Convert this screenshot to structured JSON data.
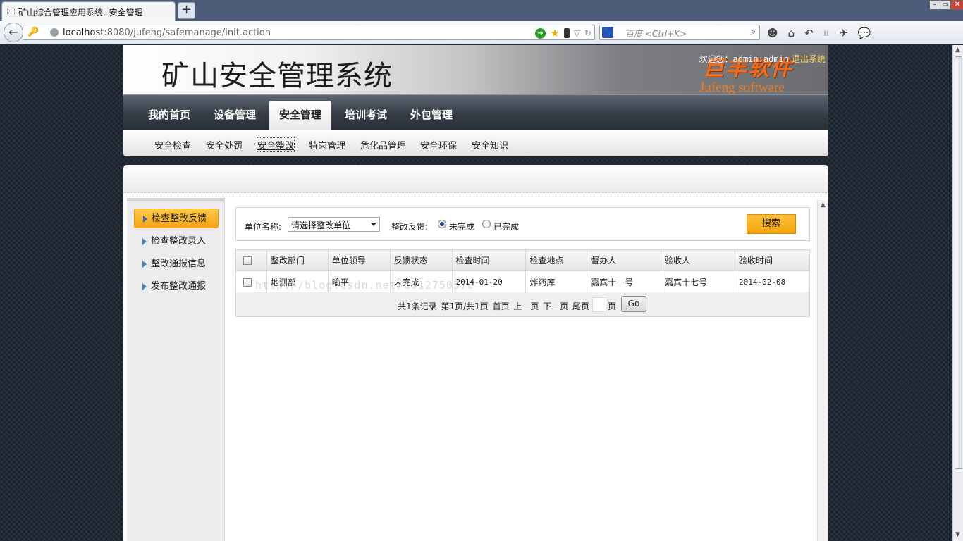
{
  "browser": {
    "tab_title": "矿山综合管理应用系统--安全管理",
    "new_tab": "+",
    "url_host": "localhost",
    "url_rest": ":8080/jufeng/safemanage/init.action",
    "search_placeholder": "百度 <Ctrl+K>",
    "window_controls": [
      "minimize-icon",
      "restore-icon",
      "close-icon"
    ]
  },
  "header": {
    "system_title": "矿山安全管理系统",
    "welcome_prefix": "欢迎您：",
    "welcome_user": "admin:admin",
    "logout": "退出系统",
    "logo_cn": "巨丰软件",
    "logo_en": "Jufeng software"
  },
  "main_nav": [
    "我的首页",
    "设备管理",
    "安全管理",
    "培训考试",
    "外包管理"
  ],
  "main_nav_active": "安全管理",
  "sub_nav": [
    "安全检查",
    "安全处罚",
    "安全整改",
    "特岗管理",
    "危化品管理",
    "安全环保",
    "安全知识"
  ],
  "sub_nav_active": "安全整改",
  "sidebar": {
    "items": [
      "检查整改反馈",
      "检查整改录入",
      "整改通报信息",
      "发布整改通报"
    ],
    "active": "检查整改反馈"
  },
  "search": {
    "unit_label": "单位名称:",
    "unit_value": "请选择整改单位",
    "feedback_label": "整改反馈:",
    "radio_options": [
      "未完成",
      "已完成"
    ],
    "radio_selected": "未完成",
    "search_button": "搜索"
  },
  "table": {
    "columns": [
      "整改部门",
      "单位领导",
      "反馈状态",
      "检查时间",
      "检查地点",
      "督办人",
      "验收人",
      "验收时间"
    ],
    "rows": [
      [
        "地测部",
        "喻平",
        "未完成",
        "2014-01-20",
        "炸药库",
        "嘉宾十一号",
        "嘉宾十七号",
        "2014-02-08"
      ]
    ]
  },
  "pager": {
    "summary": "共1条记录 第1页/共1页 首页 上一页 下一页 尾页",
    "page_unit": "页",
    "go": "Go"
  },
  "watermark": "http://blog.csdn.net/u012750578",
  "colors": {
    "accent": "#f4a40a",
    "nav_dark": "#363d47",
    "logo_orange": "#ff6a13"
  }
}
